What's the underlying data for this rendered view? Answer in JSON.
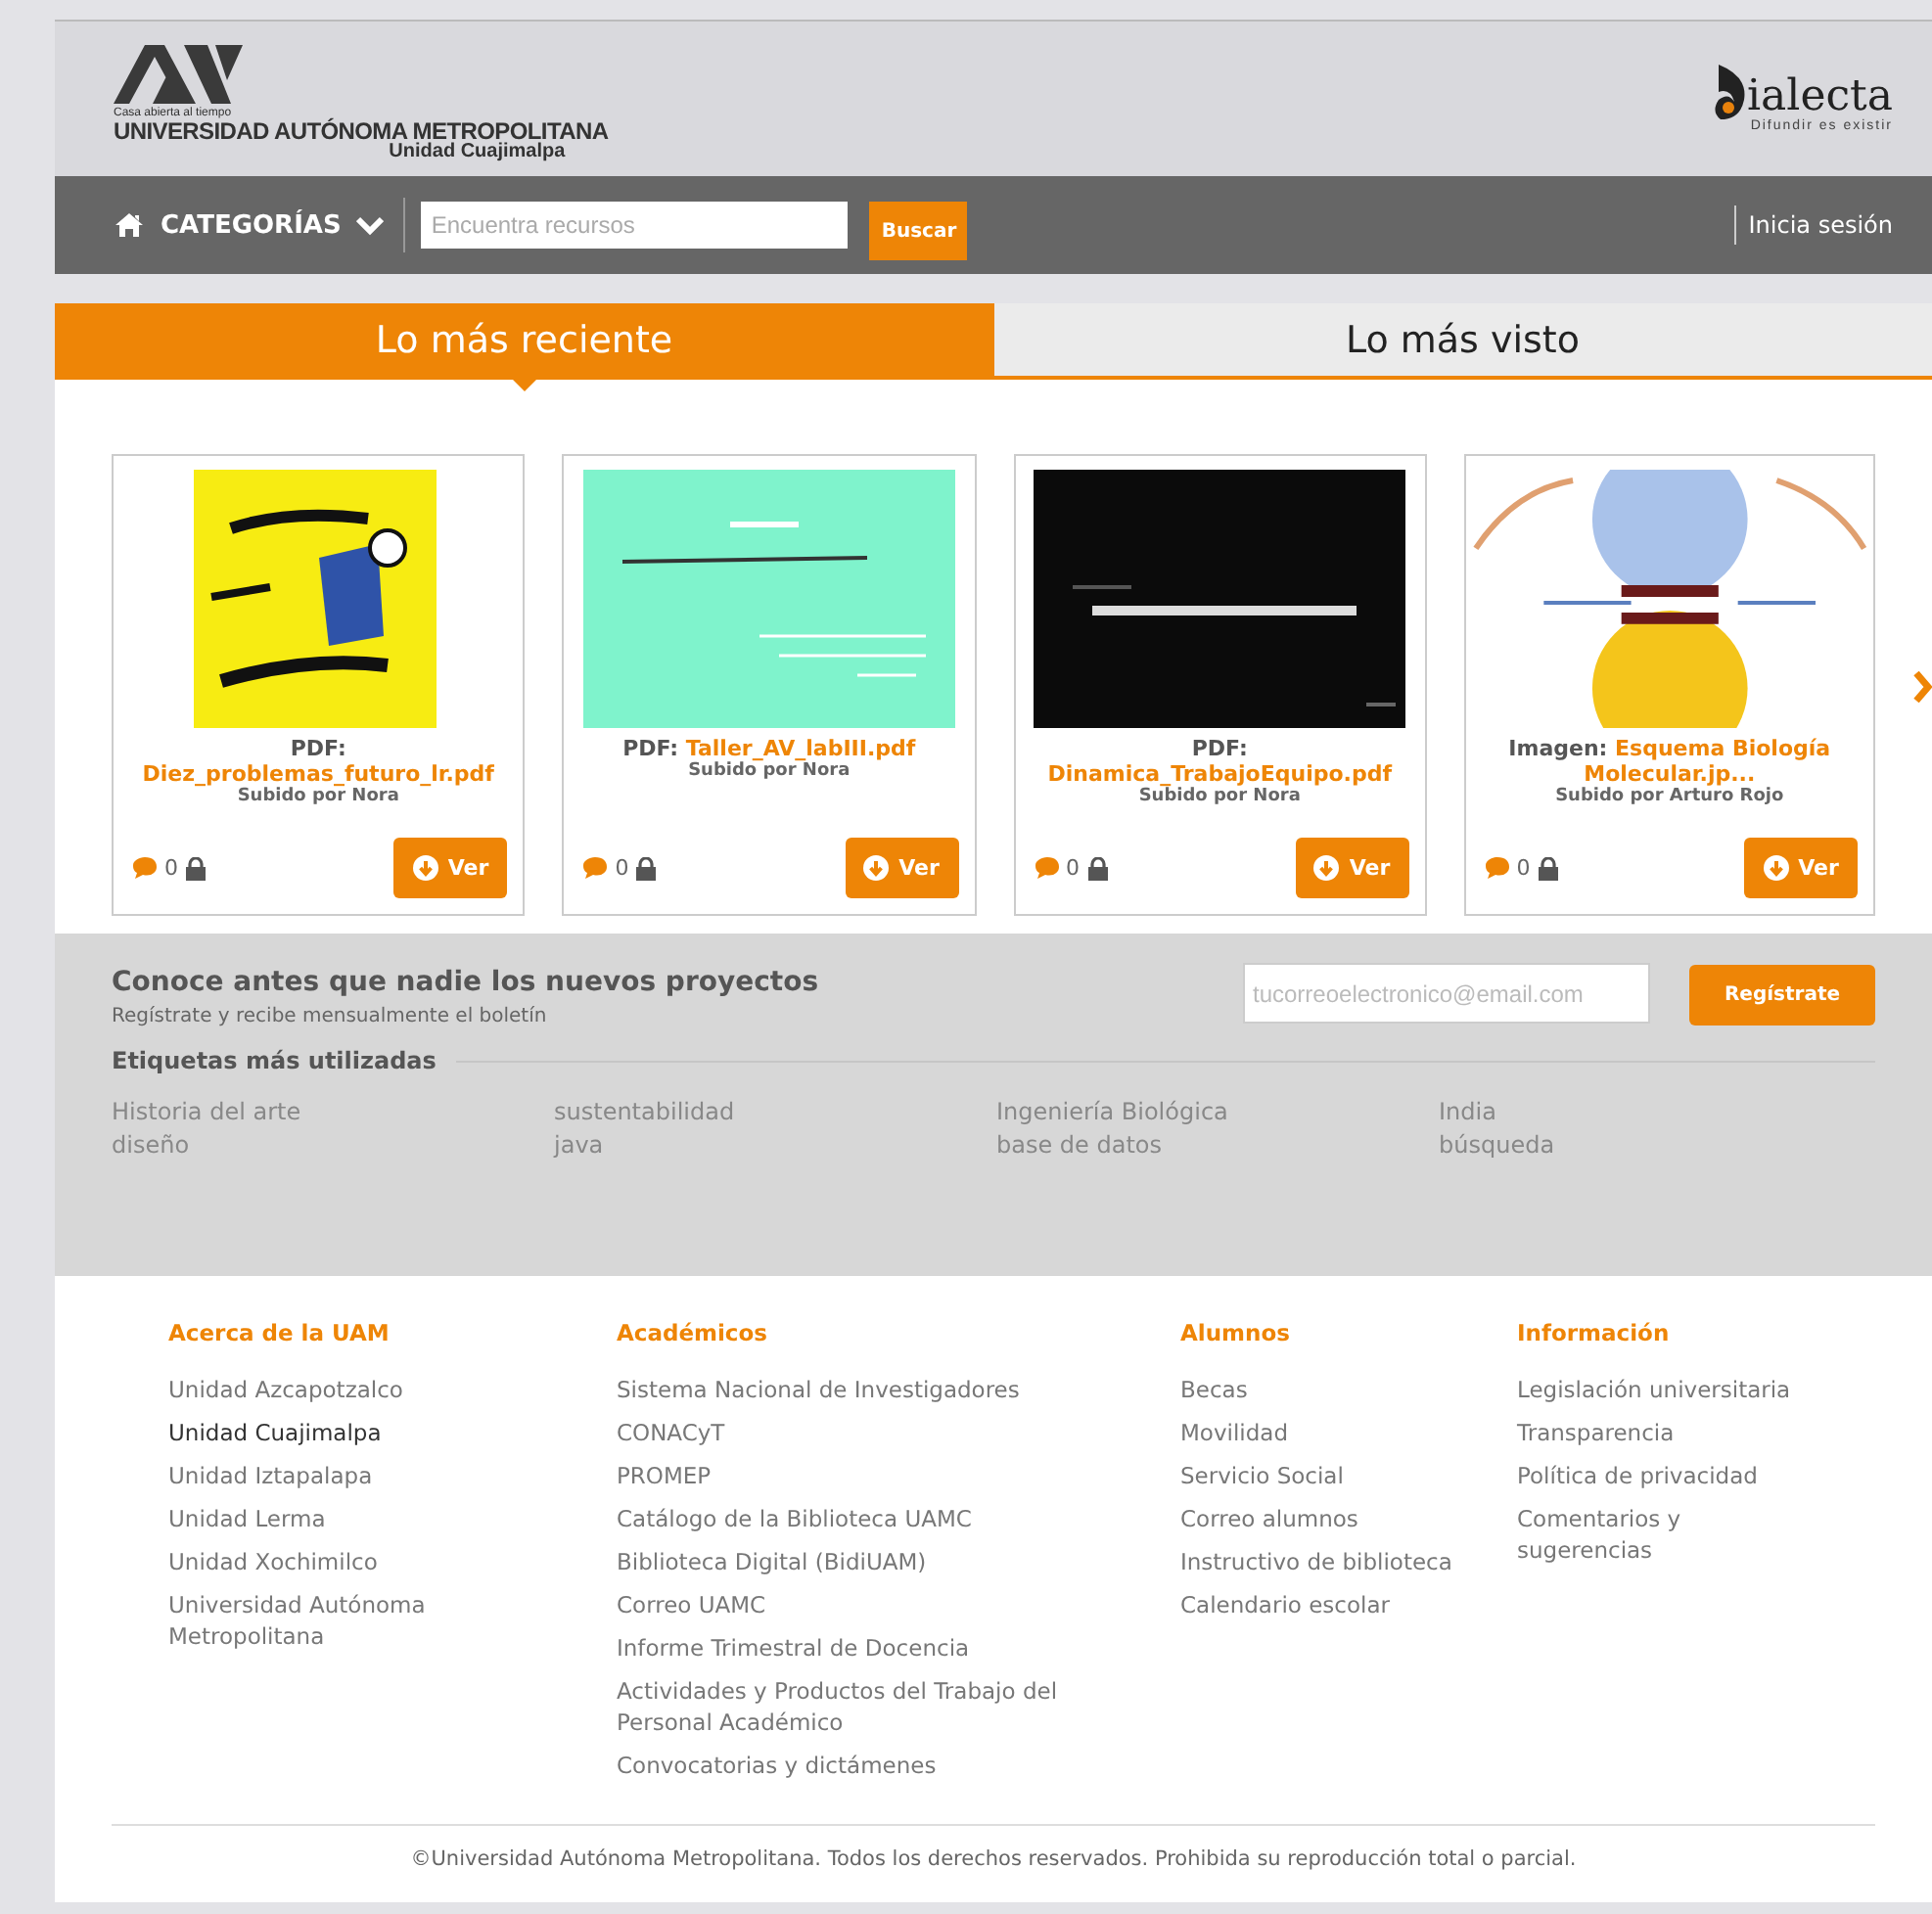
{
  "header": {
    "uam_tagline": "Casa abierta al tiempo",
    "uam_name": "UNIVERSIDAD AUTÓNOMA METROPOLITANA",
    "uam_unit": "Unidad Cuajimalpa",
    "brand_text": "ialecta",
    "brand_tagline": "Difundir es existir"
  },
  "nav": {
    "categories": "CATEGORÍAS",
    "search": {
      "placeholder": "Encuentra recursos"
    },
    "search_button": "Buscar",
    "login": "Inicia sesión"
  },
  "tabs": [
    {
      "label": "Lo más reciente",
      "selected": true
    },
    {
      "label": "Lo más visto",
      "selected": false
    }
  ],
  "cards": [
    {
      "type": "PDF:",
      "file": "Diez_problemas_futuro_lr.pdf",
      "uploader": "Subido por Nora",
      "comments": "0",
      "locked": true,
      "button": "Ver"
    },
    {
      "type": "PDF:",
      "file": "Taller_AV_labIII.pdf",
      "uploader": "Subido por Nora",
      "comments": "0",
      "locked": true,
      "button": "Ver"
    },
    {
      "type": "PDF:",
      "file": "Dinamica_TrabajoEquipo.pdf",
      "uploader": "Subido por Nora",
      "comments": "0",
      "locked": true,
      "button": "Ver"
    },
    {
      "type": "Imagen:",
      "file": "Esquema Biología Molecular.jp...",
      "uploader": "Subido por Arturo Rojo",
      "comments": "0",
      "locked": true,
      "button": "Ver"
    }
  ],
  "newsletter": {
    "title": "Conoce antes que nadie los nuevos proyectos",
    "subtitle": "Regístrate y recibe mensualmente el boletín",
    "email": {
      "placeholder": "tucorreoelectronico@email.com"
    },
    "button": "Regístrate"
  },
  "tags": {
    "title": "Etiquetas más utilizadas",
    "items": [
      "Historia del arte",
      "sustentabilidad",
      "Ingeniería Biológica",
      "India",
      "diseño",
      "java",
      "base de datos",
      "búsqueda"
    ]
  },
  "footer": {
    "columns": [
      {
        "title": "Acerca de la UAM",
        "links": [
          {
            "label": "Unidad Azcapotzalco",
            "active": false
          },
          {
            "label": "Unidad Cuajimalpa",
            "active": true
          },
          {
            "label": "Unidad Iztapalapa",
            "active": false
          },
          {
            "label": "Unidad Lerma",
            "active": false
          },
          {
            "label": "Unidad Xochimilco",
            "active": false
          },
          {
            "label": "Universidad Autónoma Metropolitana",
            "active": false
          }
        ]
      },
      {
        "title": "Académicos",
        "links": [
          {
            "label": "Sistema Nacional de Investigadores",
            "active": false
          },
          {
            "label": "CONACyT",
            "active": false
          },
          {
            "label": "PROMEP",
            "active": false
          },
          {
            "label": "Catálogo de la Biblioteca UAMC",
            "active": false
          },
          {
            "label": "Biblioteca Digital (BidiUAM)",
            "active": false
          },
          {
            "label": "Correo UAMC",
            "active": false
          },
          {
            "label": "Informe Trimestral de Docencia",
            "active": false
          },
          {
            "label": "Actividades y Productos del Trabajo del Personal Académico",
            "active": false
          },
          {
            "label": "Convocatorias y dictámenes",
            "active": false
          }
        ]
      },
      {
        "title": "Alumnos",
        "links": [
          {
            "label": "Becas",
            "active": false
          },
          {
            "label": "Movilidad",
            "active": false
          },
          {
            "label": "Servicio Social",
            "active": false
          },
          {
            "label": "Correo alumnos",
            "active": false
          },
          {
            "label": "Instructivo de biblioteca",
            "active": false
          },
          {
            "label": "Calendario escolar",
            "active": false
          }
        ]
      },
      {
        "title": "Información",
        "links": [
          {
            "label": "Legislación universitaria",
            "active": false
          },
          {
            "label": "Transparencia",
            "active": false
          },
          {
            "label": "Política de privacidad",
            "active": false
          },
          {
            "label": "Comentarios y sugerencias",
            "active": false
          }
        ]
      }
    ],
    "copyright": "©Universidad Autónoma Metropolitana. Todos los derechos reservados. Prohibida su reproducción total o parcial."
  }
}
